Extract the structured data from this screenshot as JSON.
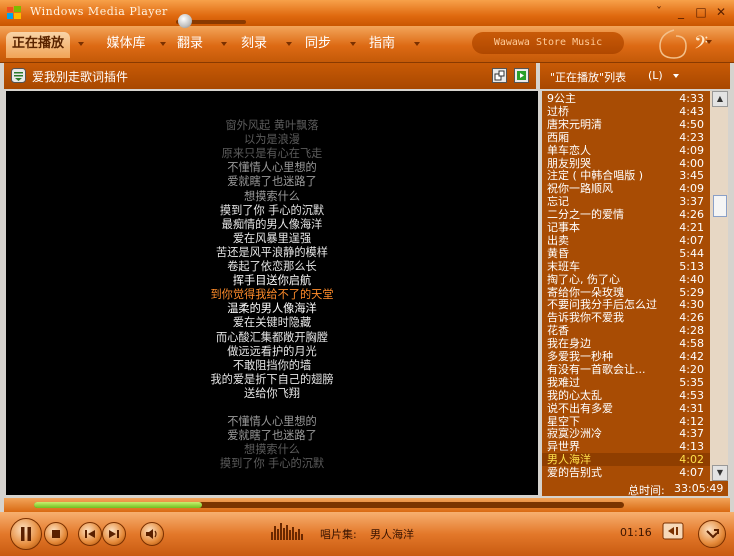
{
  "window": {
    "title": "Windows Media Player",
    "minimize_glyph": "ˇ",
    "restore_glyph": "_",
    "maximize_glyph": "□",
    "close_glyph": "✕"
  },
  "tabs": [
    {
      "label": "正在播放",
      "active": true
    },
    {
      "label": "媒体库"
    },
    {
      "label": "翻录"
    },
    {
      "label": "刻录"
    },
    {
      "label": "同步"
    },
    {
      "label": "指南"
    }
  ],
  "store": {
    "label": "Wawawa Store Music"
  },
  "lyrics_panel": {
    "header": "爱我别走歌词插件",
    "lines": [
      {
        "text": "窗外风起 黄叶飘落",
        "state": "faded"
      },
      {
        "text": "以为是浪漫",
        "state": "faded"
      },
      {
        "text": "原来只是有心在飞走",
        "state": "faded"
      },
      {
        "text": "不懂情人心里想的",
        "state": "dim"
      },
      {
        "text": "爱就瞎了也迷路了",
        "state": "dim"
      },
      {
        "text": "想摸索什么",
        "state": "dim"
      },
      {
        "text": "摸到了你 手心的沉默",
        "state": "normal"
      },
      {
        "text": "最痴情的男人像海洋",
        "state": "normal"
      },
      {
        "text": "爱在风暴里逞强",
        "state": "normal"
      },
      {
        "text": "苦还是风平浪静的模样",
        "state": "normal"
      },
      {
        "text": "卷起了依恋那么长",
        "state": "normal"
      },
      {
        "text": "挥手目送你启航",
        "state": "bright"
      },
      {
        "text": "到你觉得我给不了的天堂",
        "state": "current"
      },
      {
        "text": "温柔的男人像海洋",
        "state": "bright"
      },
      {
        "text": "爱在关键时隐藏",
        "state": "normal"
      },
      {
        "text": "而心酸汇集都敞开胸膛",
        "state": "normal"
      },
      {
        "text": "做远远看护的月光",
        "state": "normal"
      },
      {
        "text": "不敢阻挡你的墙",
        "state": "normal"
      },
      {
        "text": "我的爱是折下自己的翅膀",
        "state": "normal"
      },
      {
        "text": "送给你飞翔",
        "state": "normal"
      },
      {
        "text": "",
        "state": "normal"
      },
      {
        "text": "不懂情人心里想的",
        "state": "dim"
      },
      {
        "text": "爱就瞎了也迷路了",
        "state": "dim"
      },
      {
        "text": "想摸索什么",
        "state": "faded"
      },
      {
        "text": "摸到了你 手心的沉默",
        "state": "faded"
      }
    ]
  },
  "playlist": {
    "header": "\"正在播放\"列表",
    "header_shortcut": "(L)",
    "items": [
      {
        "title": "9公主",
        "duration": "4:33"
      },
      {
        "title": "过桥",
        "duration": "4:43"
      },
      {
        "title": "唐宋元明清",
        "duration": "4:50"
      },
      {
        "title": "西厢",
        "duration": "4:23"
      },
      {
        "title": "单车恋人",
        "duration": "4:09"
      },
      {
        "title": "朋友别哭",
        "duration": "4:00"
      },
      {
        "title": "注定 ( 中韩合唱版 )",
        "duration": "3:45"
      },
      {
        "title": "祝你一路顺风",
        "duration": "4:09"
      },
      {
        "title": "忘记",
        "duration": "3:37"
      },
      {
        "title": "二分之一的爱情",
        "duration": "4:26"
      },
      {
        "title": "记事本",
        "duration": "4:21"
      },
      {
        "title": "出卖",
        "duration": "4:07"
      },
      {
        "title": "黄昏",
        "duration": "5:44"
      },
      {
        "title": "末班车",
        "duration": "5:13"
      },
      {
        "title": "掏了心, 伤了心",
        "duration": "4:40"
      },
      {
        "title": "寄给你一朵玫瑰",
        "duration": "5:29"
      },
      {
        "title": "不要问我分手后怎么过",
        "duration": "4:30"
      },
      {
        "title": "告诉我你不爱我",
        "duration": "4:26"
      },
      {
        "title": "花香",
        "duration": "4:28"
      },
      {
        "title": "我在身边",
        "duration": "4:58"
      },
      {
        "title": "多爱我一秒种",
        "duration": "4:42"
      },
      {
        "title": "有没有一首歌会让...",
        "duration": "4:20"
      },
      {
        "title": "我难过",
        "duration": "5:35"
      },
      {
        "title": "我的心太乱",
        "duration": "4:53"
      },
      {
        "title": "说不出有多爱",
        "duration": "4:31"
      },
      {
        "title": "星空下",
        "duration": "4:12"
      },
      {
        "title": "寂寞沙洲冷",
        "duration": "4:37"
      },
      {
        "title": "异世界",
        "duration": "4:13"
      },
      {
        "title": "男人海洋",
        "duration": "4:02",
        "current": true
      },
      {
        "title": "爱的告别式",
        "duration": "4:07"
      }
    ],
    "total_label": "总时间:",
    "total_time": "33:05:49"
  },
  "player": {
    "progress": 0.285,
    "album_label": "唱片集:",
    "album": "男人海洋",
    "elapsed": "01:16"
  },
  "colors": {
    "accent": "#e06a10",
    "lyric_current": "#ff8c2a",
    "playlist_bg": "#a84c04",
    "playlist_current_text": "#ffe04a"
  }
}
